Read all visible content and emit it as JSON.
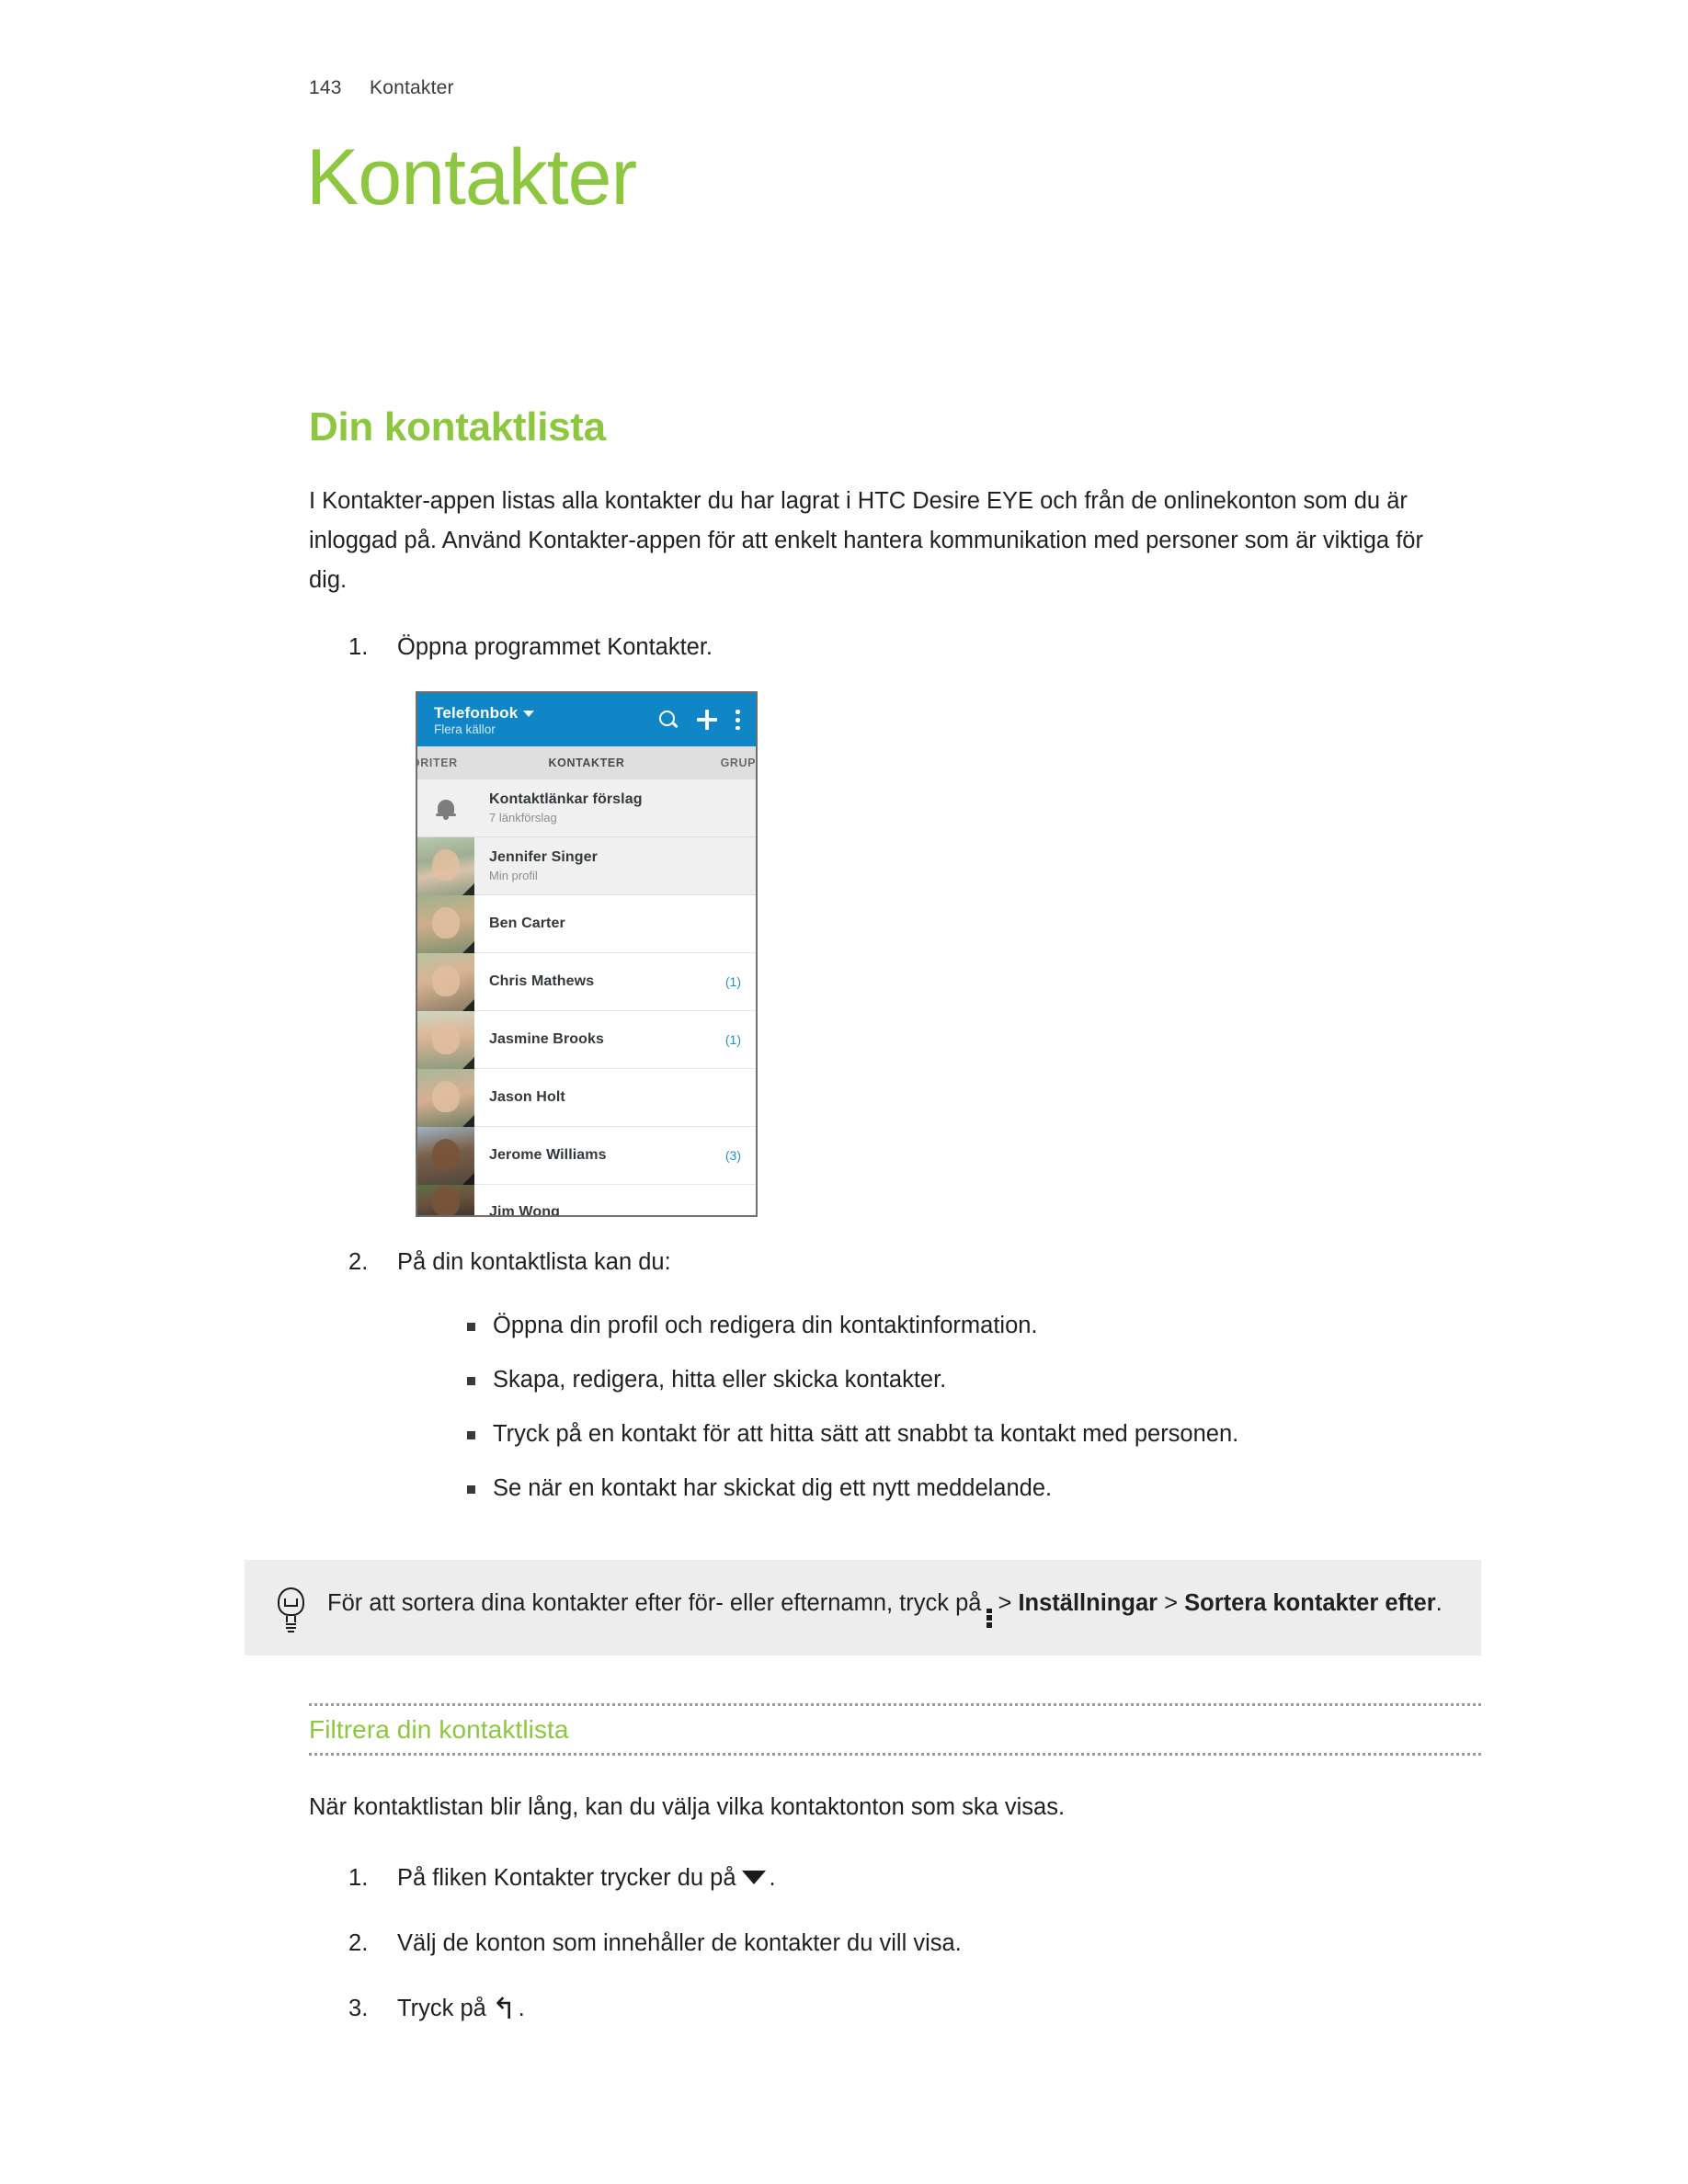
{
  "page_header": {
    "page_number": "143",
    "chapter": "Kontakter"
  },
  "chapter_title": "Kontakter",
  "section": {
    "title": "Din kontaktlista",
    "intro": "I Kontakter-appen listas alla kontakter du har lagrat i HTC Desire EYE och från de onlinekonton som du är inloggad på. Använd Kontakter-appen för att enkelt hantera kommunikation med personer som är viktiga för dig.",
    "steps": [
      {
        "text": "Öppna programmet Kontakter."
      },
      {
        "text": "På din kontaktlista kan du:"
      }
    ],
    "bullets": [
      "Öppna din profil och redigera din kontaktinformation.",
      "Skapa, redigera, hitta eller skicka kontakter.",
      "Tryck på en kontakt för att hitta sätt att snabbt ta kontakt med personen.",
      "Se när en kontakt har skickat dig ett nytt meddelande."
    ]
  },
  "screenshot": {
    "appbar": {
      "title": "Telefonbok",
      "subtitle": "Flera källor",
      "icons": [
        "search-icon",
        "plus-icon",
        "overflow-menu-icon"
      ]
    },
    "tabs": [
      {
        "label": "VORITER"
      },
      {
        "label": "KONTAKTER"
      },
      {
        "label": "GRUPPE"
      }
    ],
    "rows": [
      {
        "name": "Kontaktlänkar förslag",
        "sub": "7 länkförslag",
        "badge": "",
        "icon": "bell-icon"
      },
      {
        "name": "Jennifer Singer",
        "sub": "Min profil",
        "badge": ""
      },
      {
        "name": "Ben Carter",
        "sub": "",
        "badge": ""
      },
      {
        "name": "Chris Mathews",
        "sub": "",
        "badge": "(1)"
      },
      {
        "name": "Jasmine Brooks",
        "sub": "",
        "badge": "(1)"
      },
      {
        "name": "Jason Holt",
        "sub": "",
        "badge": ""
      },
      {
        "name": "Jerome Williams",
        "sub": "",
        "badge": "(3)"
      },
      {
        "name": "Jim Wong",
        "sub": "",
        "badge": ""
      }
    ]
  },
  "tip": {
    "text_before": "För att sortera dina kontakter efter för- eller efternamn, tryck på",
    "separator_1": "> ",
    "bold_1": "Inställningar",
    "separator_2": " > ",
    "bold_2": "Sortera kontakter efter",
    "text_after": "."
  },
  "subsection": {
    "title": "Filtrera din kontaktlista",
    "intro": "När kontaktlistan blir lång, kan du välja vilka kontaktonton som ska visas.",
    "steps": [
      {
        "prefix": "På fliken Kontakter trycker du på",
        "icon": "triangle-down-icon",
        "suffix": "."
      },
      {
        "prefix": "Välj de konton som innehåller de kontakter du vill visa.",
        "icon": "",
        "suffix": ""
      },
      {
        "prefix": "Tryck på",
        "icon": "back-arrow-icon",
        "suffix": "."
      }
    ]
  },
  "colors": {
    "accent_green": "#8dc63f",
    "app_blue": "#1186c6",
    "badge_blue": "#1e92d0",
    "tip_bg": "#ededed",
    "text": "#231f20"
  }
}
